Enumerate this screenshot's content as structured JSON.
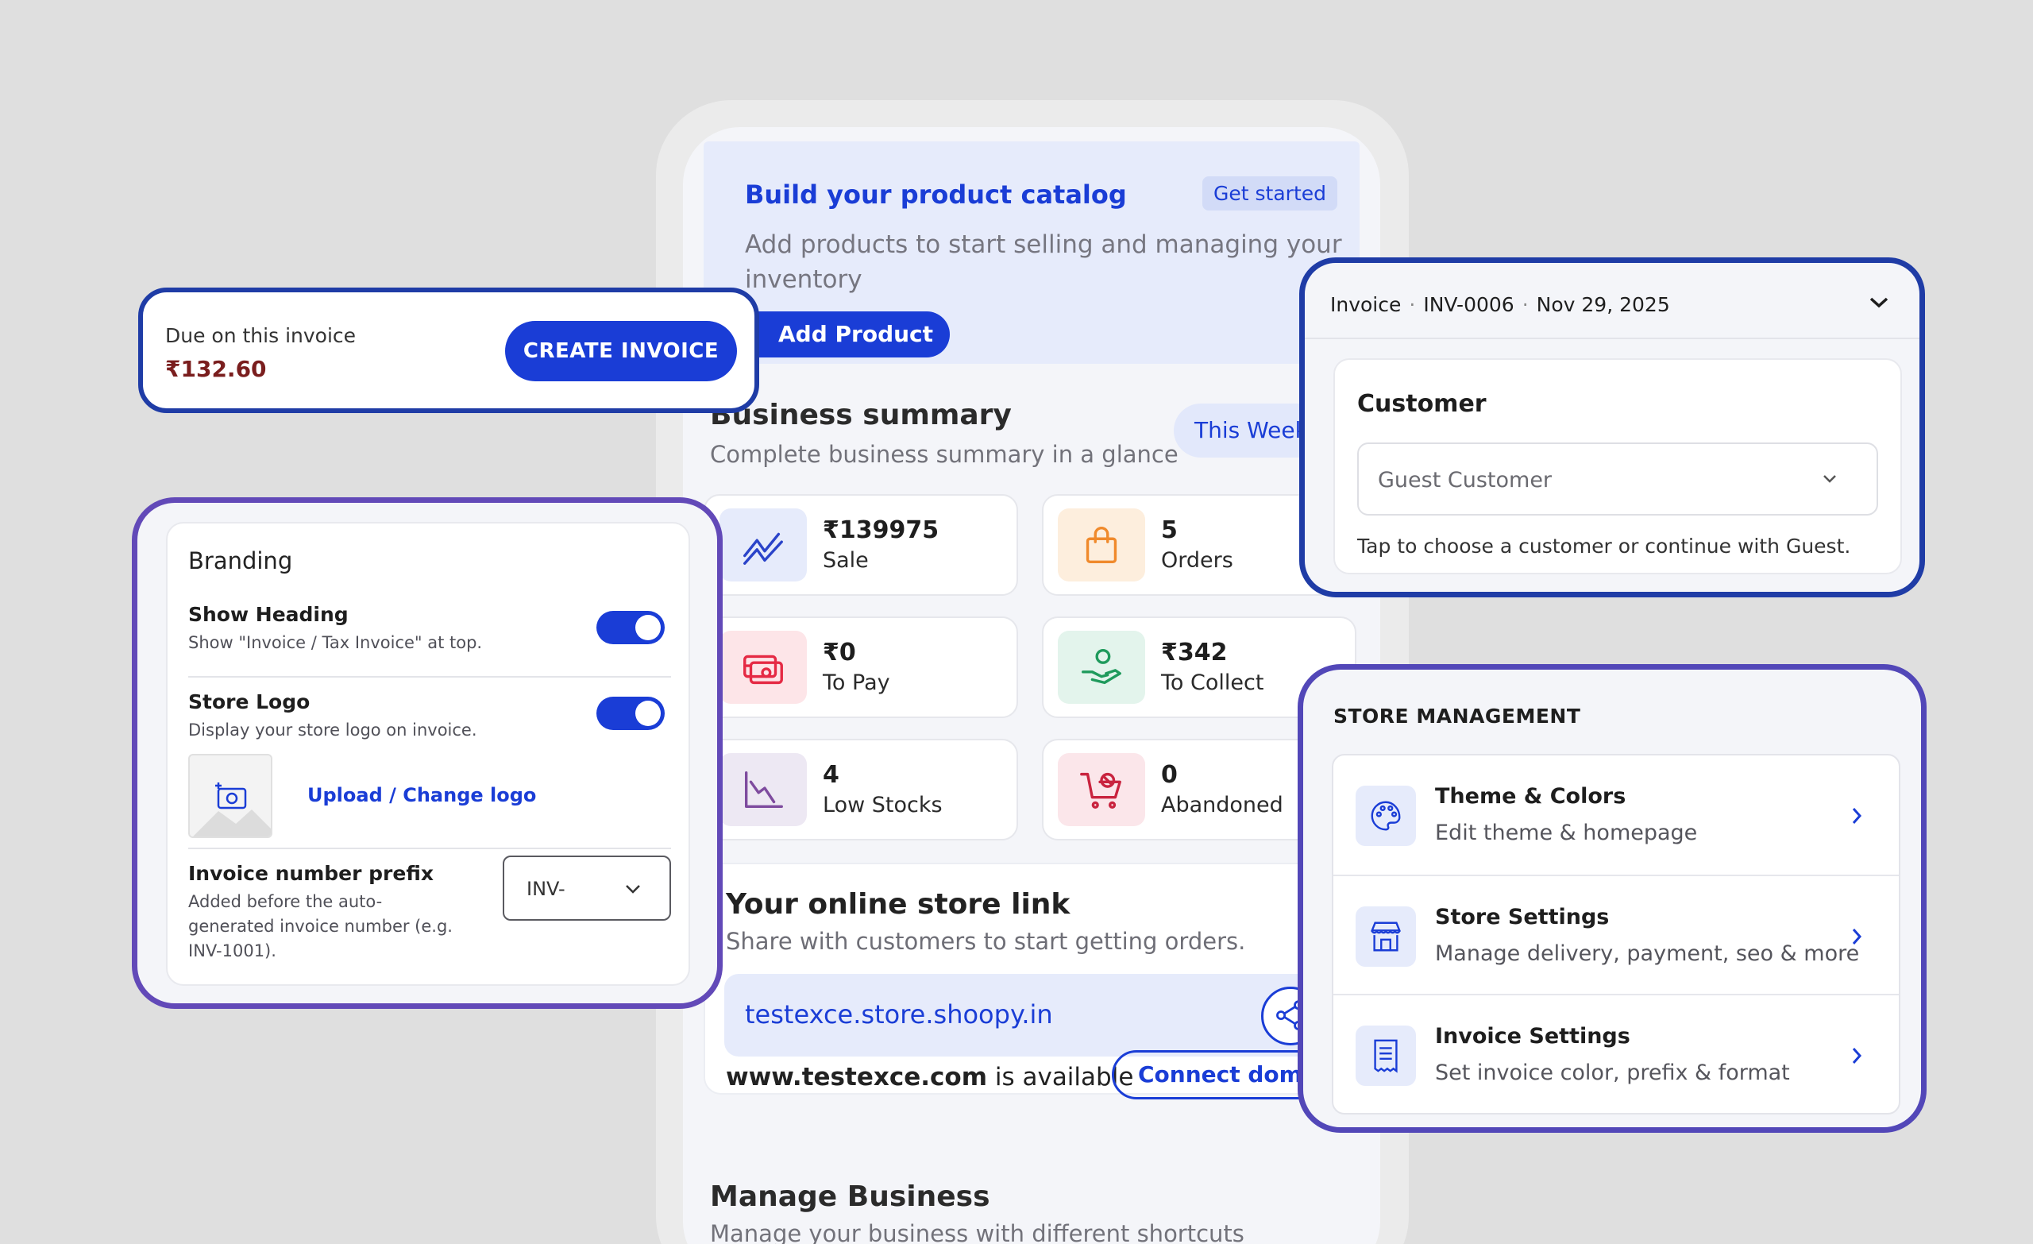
{
  "catalog": {
    "title": "Build your product catalog",
    "badge": "Get started",
    "description": "Add products to start selling and managing your inventory",
    "button": "Add Product"
  },
  "business_summary": {
    "title": "Business summary",
    "subtitle": "Complete business summary in a glance",
    "period": "This Week",
    "stats": [
      {
        "value": "₹139975",
        "label": "Sale",
        "icon": "trend-chart-icon",
        "color": "#e6ebfb",
        "accent": "#2a43c9"
      },
      {
        "value": "5",
        "label": "Orders",
        "icon": "shopping-bag-icon",
        "color": "#fdeedd",
        "accent": "#f08a2c"
      },
      {
        "value": "₹0",
        "label": "To Pay",
        "icon": "cash-out-icon",
        "color": "#fde5e8",
        "accent": "#e52a44"
      },
      {
        "value": "₹342",
        "label": "To Collect",
        "icon": "hand-coin-icon",
        "color": "#e3f4ec",
        "accent": "#1f9a5c"
      },
      {
        "value": "4",
        "label": "Low Stocks",
        "icon": "declining-chart-icon",
        "color": "#ede8f3",
        "accent": "#7e4b9e"
      },
      {
        "value": "0",
        "label": "Abandoned",
        "icon": "cart-cancel-icon",
        "color": "#fbe6ea",
        "accent": "#c9243f"
      }
    ]
  },
  "online_store": {
    "title": "Your online store link",
    "subtitle": "Share with customers to start getting orders.",
    "link": "testexce.store.shoopy.in",
    "domain": "www.testexce.com",
    "domain_suffix": " is available",
    "connect_button": "Connect domain"
  },
  "manage_business": {
    "title": "Manage Business",
    "subtitle": "Manage your business with different shortcuts"
  },
  "due_card": {
    "label": "Due on this invoice",
    "amount": "₹132.60",
    "button": "CREATE INVOICE"
  },
  "branding": {
    "title": "Branding",
    "show_heading": {
      "title": "Show Heading",
      "desc": "Show \"Invoice / Tax Invoice\" at top.",
      "enabled": true
    },
    "store_logo": {
      "title": "Store Logo",
      "desc": "Display your store logo on invoice.",
      "enabled": true
    },
    "upload_link": "Upload / Change logo",
    "prefix": {
      "title": "Invoice number prefix",
      "desc_lines": [
        "Added before the auto-",
        "generated invoice number (e.g.",
        "INV-1001)."
      ],
      "value": "INV-"
    }
  },
  "invoice": {
    "label": "Invoice",
    "number": "INV-0006",
    "date": "Nov 29, 2025",
    "separator": "·",
    "customer": {
      "title": "Customer",
      "selected": "Guest Customer",
      "note": "Tap to choose a customer or continue with Guest."
    }
  },
  "store_management": {
    "title": "STORE MANAGEMENT",
    "items": [
      {
        "name": "Theme & Colors",
        "desc": "Edit theme & homepage",
        "icon": "palette-icon"
      },
      {
        "name": "Store Settings",
        "desc": "Manage delivery, payment, seo & more",
        "icon": "storefront-icon"
      },
      {
        "name": "Invoice Settings",
        "desc": "Set invoice color, prefix & format",
        "icon": "receipt-icon"
      }
    ]
  }
}
